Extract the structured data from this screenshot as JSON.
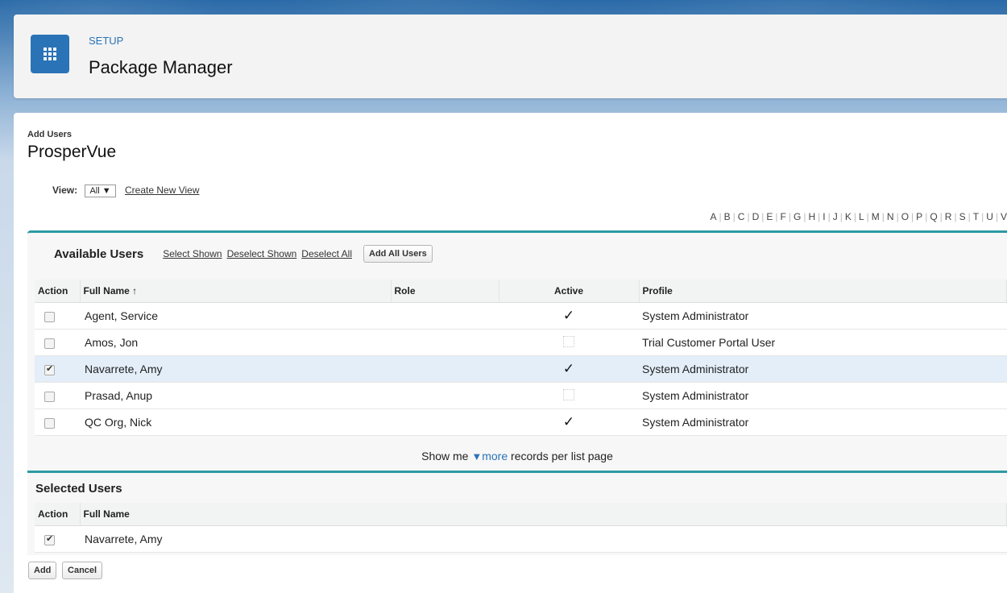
{
  "header": {
    "section": "SETUP",
    "title": "Package Manager",
    "icon": "app-grid-icon"
  },
  "page": {
    "small_title": "Add Users",
    "title": "ProsperVue"
  },
  "view": {
    "label": "View:",
    "selected": "All",
    "create_link": "Create New View"
  },
  "alpha": [
    "A",
    "B",
    "C",
    "D",
    "E",
    "F",
    "G",
    "H",
    "I",
    "J",
    "K",
    "L",
    "M",
    "N",
    "O",
    "P",
    "Q",
    "R",
    "S",
    "T",
    "U",
    "V"
  ],
  "available": {
    "title": "Available Users",
    "select_shown": "Select Shown",
    "deselect_shown": "Deselect Shown",
    "deselect_all": "Deselect All",
    "add_all_button": "Add All Users",
    "columns": [
      "Action",
      "Full Name ↑",
      "Role",
      "Active",
      "Profile"
    ],
    "rows": [
      {
        "checked": false,
        "name": "Agent, Service",
        "role": "",
        "active": true,
        "profile": "System Administrator"
      },
      {
        "checked": false,
        "name": "Amos, Jon",
        "role": "",
        "active": false,
        "profile": "Trial Customer Portal User"
      },
      {
        "checked": true,
        "name": "Navarrete, Amy",
        "role": "",
        "active": true,
        "profile": "System Administrator"
      },
      {
        "checked": false,
        "name": "Prasad, Anup",
        "role": "",
        "active": false,
        "profile": "System Administrator"
      },
      {
        "checked": false,
        "name": "QC Org, Nick",
        "role": "",
        "active": true,
        "profile": "System Administrator"
      }
    ],
    "show_me_prefix": "Show me",
    "show_me_link": "more",
    "show_me_suffix": "records per list page"
  },
  "selected_users": {
    "title": "Selected Users",
    "columns": [
      "Action",
      "Full Name"
    ],
    "rows": [
      {
        "checked": true,
        "name": "Navarrete, Amy"
      }
    ]
  },
  "buttons": {
    "add": "Add",
    "cancel": "Cancel"
  }
}
